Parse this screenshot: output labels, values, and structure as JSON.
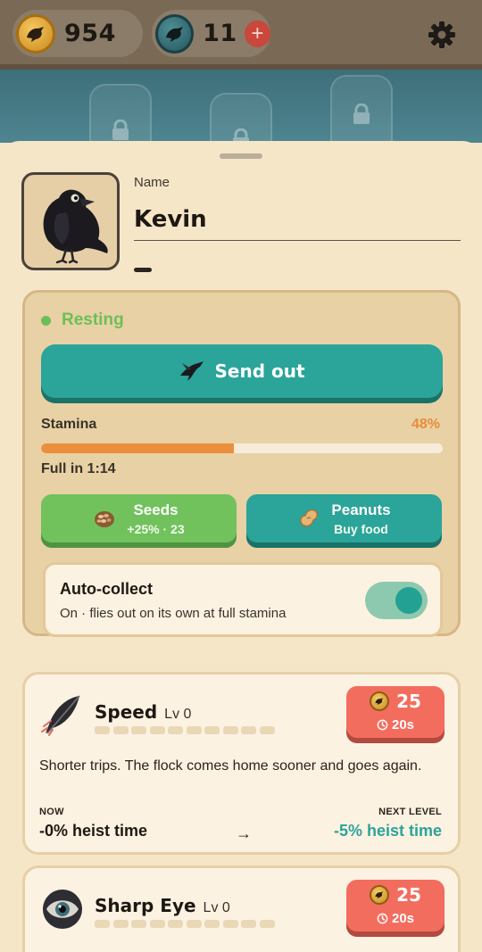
{
  "currency": {
    "coins": "954",
    "gems": "11",
    "add_gems_label": "+"
  },
  "colors": {
    "accent_teal": "#2ba49a",
    "status_green": "#6cbf58",
    "stamina_orange": "#ec8f3c",
    "cost_red": "#f36d5e"
  },
  "crow": {
    "name_label": "Name",
    "name": "Kevin",
    "status": "Resting"
  },
  "actions": {
    "send_out_label": "Send out"
  },
  "stamina": {
    "label": "Stamina",
    "percent_text": "48%",
    "fraction": 0.48,
    "full_in": "Full in 1:14"
  },
  "food": {
    "seeds_title": "Seeds",
    "seeds_sub": "+25% · 23",
    "peanuts_title": "Peanuts",
    "peanuts_sub": "Buy food"
  },
  "auto_collect": {
    "title": "Auto-collect",
    "subtitle": "On · flies out on its own at full stamina",
    "enabled": true
  },
  "upgrades": [
    {
      "name": "Speed",
      "level": "Lv 0",
      "pips_total": 10,
      "pips_filled": 0,
      "cost": "25",
      "time": "20s",
      "description": "Shorter trips. The flock comes home sooner and goes again.",
      "now_label": "NOW",
      "now_value": "-0% heist time",
      "next_label": "NEXT LEVEL",
      "next_value": "-5% heist time",
      "icon": "feather-icon"
    },
    {
      "name": "Sharp Eye",
      "level": "Lv 0",
      "pips_total": 10,
      "pips_filled": 0,
      "cost": "25",
      "time": "20s",
      "icon": "eye-icon"
    }
  ]
}
